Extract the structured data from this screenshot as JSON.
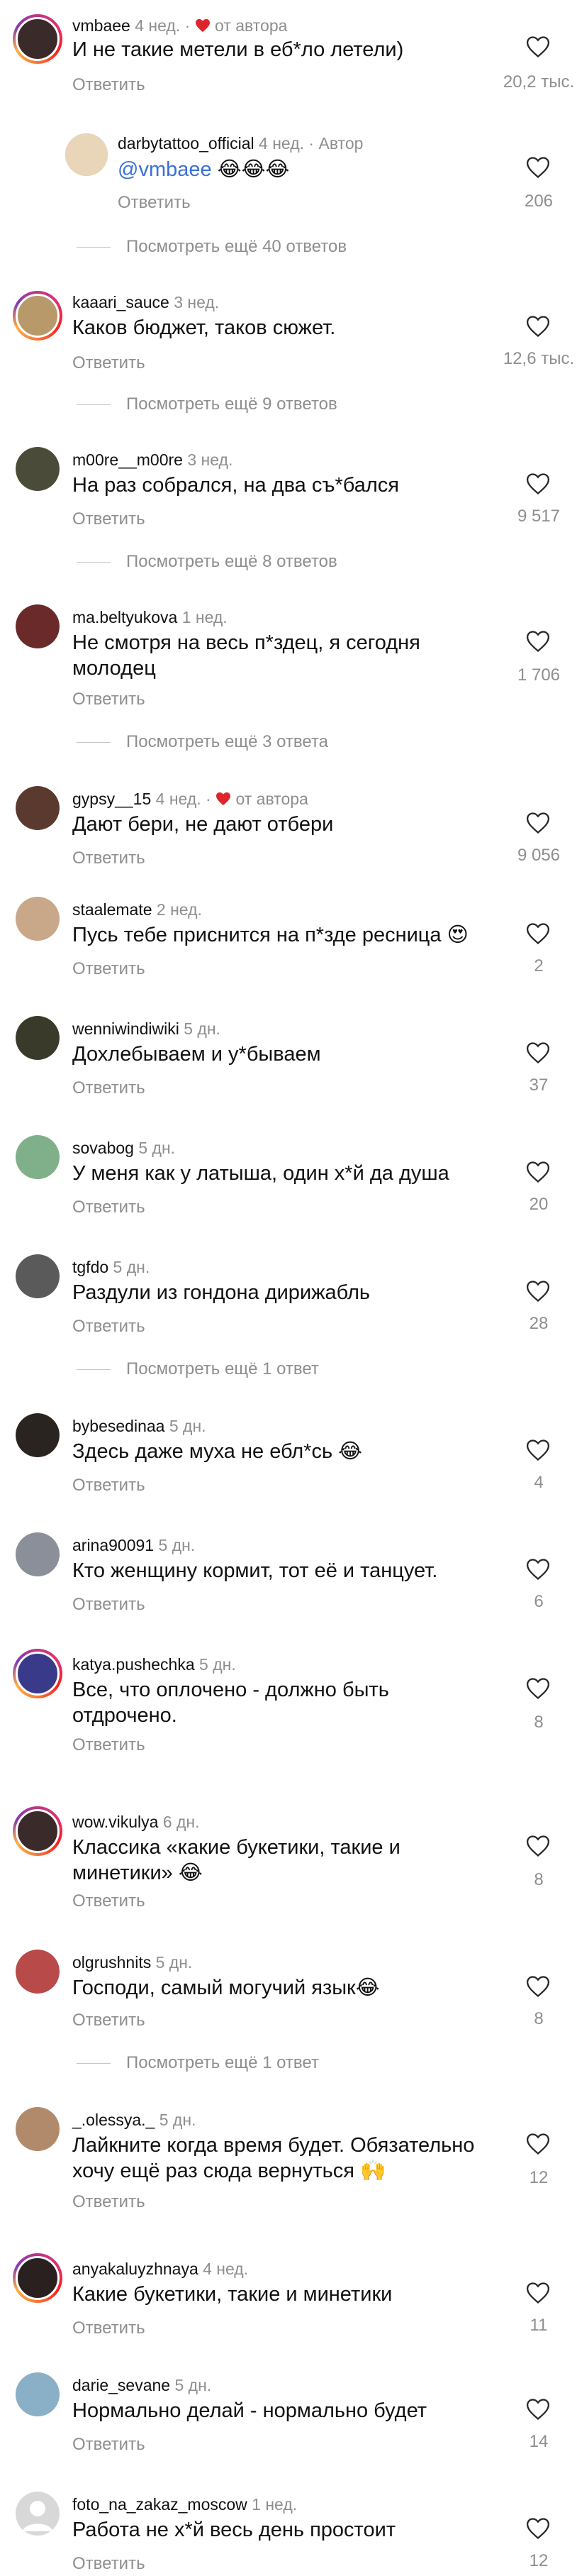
{
  "ui": {
    "reply_label": "Ответить",
    "author_label": "от автора",
    "author_reply_label": "Автор"
  },
  "comments": [
    {
      "user": "vmbaee",
      "time": "4 нед.",
      "author_like": true,
      "text": "И не такие метели в еб*ло летели)",
      "likes": "20,2 тыс.",
      "ring": true,
      "avatar_color": "#3b2a2a"
    },
    {
      "user": "darbytattoo_official",
      "time": "4 нед.",
      "is_author": true,
      "mention": "@vmbaee",
      "text": "😂😂😂",
      "likes": "206",
      "ring": false,
      "avatar_color": "#e9d5b8"
    },
    {
      "more": "Посмотреть ещё 40 ответов"
    },
    {
      "user": "kaaari_sauce",
      "time": "3 нед.",
      "text": "Каков бюджет, таков сюжет.",
      "likes": "12,6 тыс.",
      "ring": true,
      "avatar_color": "#b89a6a"
    },
    {
      "more": "Посмотреть ещё 9 ответов"
    },
    {
      "user": "m00re__m00re",
      "time": "3 нед.",
      "text": "На раз собрался, на два съ*бался",
      "likes": "9 517",
      "ring": false,
      "avatar_color": "#4b4b3a"
    },
    {
      "more": "Посмотреть ещё 8 ответов"
    },
    {
      "user": "ma.beltyukova",
      "time": "1 нед.",
      "text": "Не смотря на весь п*здец, я сегодня молодец",
      "likes": "1 706",
      "ring": false,
      "avatar_color": "#6a2a2a"
    },
    {
      "more": "Посмотреть ещё 3 ответа"
    },
    {
      "user": "gypsy__15",
      "time": "4 нед.",
      "author_like": true,
      "text": "Дают бери,  не дают отбери",
      "likes": "9 056",
      "ring": false,
      "avatar_color": "#5a3a2e"
    },
    {
      "user": "staalemate",
      "time": "2 нед.",
      "text": "Пусь тебе приснится на п*зде ресница 😍",
      "likes": "2",
      "ring": false,
      "avatar_color": "#c9a88a"
    },
    {
      "user": "wenniwindiwiki",
      "time": "5 дн.",
      "text": "Дохлебываем и у*бываем",
      "likes": "37",
      "ring": false,
      "avatar_color": "#3a3a2a"
    },
    {
      "user": "sovabog",
      "time": "5 дн.",
      "text": "У меня как у латыша, один х*й да душа",
      "likes": "20",
      "ring": false,
      "avatar_color": "#7fb08a"
    },
    {
      "user": "tgfdo",
      "time": "5 дн.",
      "text": "Раздули из гондона дирижабль",
      "likes": "28",
      "ring": false,
      "avatar_color": "#5a5a5a"
    },
    {
      "more": "Посмотреть ещё 1 ответ"
    },
    {
      "user": "bybesedinaa",
      "time": "5 дн.",
      "text": "Здесь даже муха не ебл*сь 😂",
      "likes": "4",
      "ring": false,
      "avatar_color": "#2a2420"
    },
    {
      "user": "arina90091",
      "time": "5 дн.",
      "text": "Кто женщину кормит, тот её и танцует.",
      "likes": "6",
      "ring": false,
      "avatar_color": "#8a8f99"
    },
    {
      "user": "katya.pushechka",
      "time": "5 дн.",
      "text": "Все, что оплочено - должно быть отдрочено.",
      "likes": "8",
      "ring": true,
      "avatar_color": "#3a3a8a"
    },
    {
      "user": "wow.vikulya",
      "time": "6 дн.",
      "text": "Классика «какие букетики, такие и минетики» 😂",
      "likes": "8",
      "ring": true,
      "avatar_color": "#3a2a2a"
    },
    {
      "user": "olgrushnits",
      "time": "5 дн.",
      "text": "Господи, самый могучий язык😂",
      "likes": "8",
      "ring": false,
      "avatar_color": "#b84a4a"
    },
    {
      "more": "Посмотреть ещё 1 ответ"
    },
    {
      "user": "_.olessya._",
      "time": "5 дн.",
      "text": "Лайкните когда время будет. Обязательно хочу ещё раз сюда вернуться 🙌",
      "likes": "12",
      "ring": false,
      "avatar_color": "#b08a6a"
    },
    {
      "user": "anyakaluyzhnaya",
      "time": "4 нед.",
      "text": "Какие букетики, такие и минетики",
      "likes": "11",
      "ring": true,
      "avatar_color": "#2a2020"
    },
    {
      "user": "darie_sevane",
      "time": "5 дн.",
      "text": "Нормально делай - нормально будет",
      "likes": "14",
      "ring": false,
      "avatar_color": "#8ab0c8"
    },
    {
      "user": "foto_na_zakaz_moscow",
      "time": "1 нед.",
      "text": "Работа не х*й весь день простоит",
      "likes": "12",
      "ring": false,
      "avatar_color": "#d8d8d8"
    }
  ]
}
